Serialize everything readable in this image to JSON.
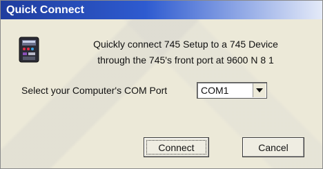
{
  "window": {
    "title": "Quick Connect"
  },
  "icons": {
    "device": "device-faceplate-icon",
    "dropdown": "chevron-down-icon"
  },
  "description": {
    "line1": "Quickly connect 745 Setup to a 745 Device",
    "line2": "through the 745's front port at 9600 N 8 1"
  },
  "com_port": {
    "label": "Select your Computer's COM Port",
    "selected": "COM1"
  },
  "buttons": {
    "connect_label": "Connect",
    "cancel_label": "Cancel"
  },
  "colors": {
    "titlebar": "#2e5bd0",
    "dialog_bg": "#ece9d8"
  }
}
